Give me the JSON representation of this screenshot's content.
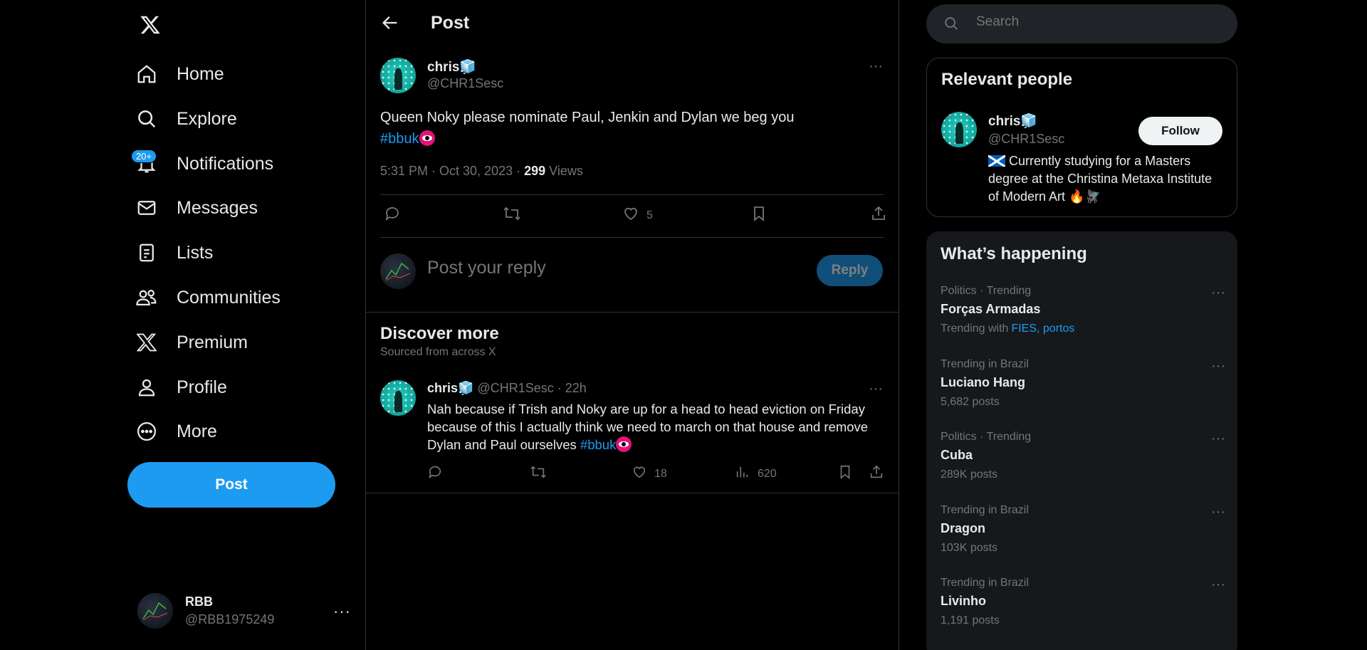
{
  "nav": {
    "items": [
      {
        "label": "Home",
        "icon": "home-icon"
      },
      {
        "label": "Explore",
        "icon": "search-icon"
      },
      {
        "label": "Notifications",
        "icon": "bell-icon",
        "badge": "20+"
      },
      {
        "label": "Messages",
        "icon": "mail-icon"
      },
      {
        "label": "Lists",
        "icon": "list-icon"
      },
      {
        "label": "Communities",
        "icon": "communities-icon"
      },
      {
        "label": "Premium",
        "icon": "x-logo-icon"
      },
      {
        "label": "Profile",
        "icon": "person-icon"
      },
      {
        "label": "More",
        "icon": "more-circle-icon"
      }
    ],
    "post_label": "Post",
    "account": {
      "name": "RBB",
      "handle": "@RBB1975249",
      "more": "···"
    }
  },
  "header": {
    "title": "Post"
  },
  "tweet": {
    "name": "chris🧊",
    "handle": "@CHR1Sesc",
    "text": "Queen Noky please nominate Paul, Jenkin and Dylan we beg you",
    "hashtag": "#bbuk",
    "meta_time": "5:31 PM · Oct 30, 2023 · ",
    "views_count": "299",
    "views_label": " Views",
    "likes": "5",
    "more": "···"
  },
  "reply": {
    "placeholder": "Post your reply",
    "button": "Reply"
  },
  "discover": {
    "title": "Discover more",
    "subtitle": "Sourced from across X",
    "post": {
      "name": "chris🧊",
      "handle": " @CHR1Sesc · 22h",
      "text": "Nah because if Trish and Noky are up for a head to head eviction on Friday because of this I actually think we need to march on that house and remove Dylan and Paul ourselves ",
      "hashtag": "#bbuk",
      "likes": "18",
      "views": "620",
      "more": "···"
    }
  },
  "search": {
    "placeholder": "Search"
  },
  "relevant": {
    "title": "Relevant people",
    "name": "chris🧊",
    "handle": "@CHR1Sesc",
    "follow": "Follow",
    "bio": " Currently studying for a Masters degree at the Christina Metaxa Institute of Modern Art 🔥🪰"
  },
  "happening": {
    "title": "What’s happening",
    "trends": [
      {
        "context": "Politics · Trending",
        "name": "Forças Armadas",
        "sub": "Trending with",
        "links": "FIES, portos"
      },
      {
        "context": "Trending in Brazil",
        "name": "Luciano Hang",
        "sub": "5,682 posts",
        "links": ""
      },
      {
        "context": "Politics · Trending",
        "name": "Cuba",
        "sub": "289K posts",
        "links": ""
      },
      {
        "context": "Trending in Brazil",
        "name": "Dragon",
        "sub": "103K posts",
        "links": ""
      },
      {
        "context": "Trending in Brazil",
        "name": "Livinho",
        "sub": "1,191 posts",
        "links": ""
      }
    ],
    "more": "···"
  },
  "colors": {
    "accent": "#1d9bf0",
    "background": "#000000",
    "muted": "#71767b",
    "text": "#e7e9ea"
  }
}
